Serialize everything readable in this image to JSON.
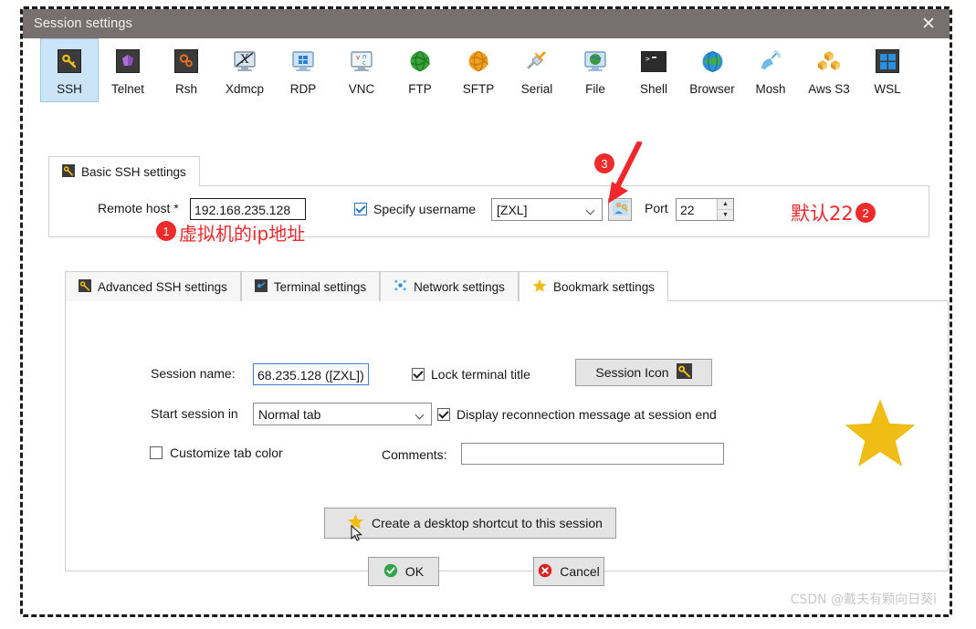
{
  "window": {
    "title": "Session settings",
    "close_icon": "close-icon"
  },
  "protocols": [
    {
      "label": "SSH",
      "icon": "key-icon",
      "selected": true
    },
    {
      "label": "Telnet",
      "icon": "purple-cube-icon",
      "selected": false
    },
    {
      "label": "Rsh",
      "icon": "orange-gears-icon",
      "selected": false
    },
    {
      "label": "Xdmcp",
      "icon": "monitor-x-icon",
      "selected": false
    },
    {
      "label": "RDP",
      "icon": "windows-monitor-icon",
      "selected": false
    },
    {
      "label": "VNC",
      "icon": "vnc-monitor-icon",
      "selected": false
    },
    {
      "label": "FTP",
      "icon": "green-globe-icon",
      "selected": false
    },
    {
      "label": "SFTP",
      "icon": "orange-globe-icon",
      "selected": false
    },
    {
      "label": "Serial",
      "icon": "serial-plug-icon",
      "selected": false
    },
    {
      "label": "File",
      "icon": "file-monitor-icon",
      "selected": false
    },
    {
      "label": "Shell",
      "icon": "terminal-icon",
      "selected": false
    },
    {
      "label": "Browser",
      "icon": "blue-globe-icon",
      "selected": false
    },
    {
      "label": "Mosh",
      "icon": "satellite-dish-icon",
      "selected": false
    },
    {
      "label": "Aws S3",
      "icon": "aws-cubes-icon",
      "selected": false
    },
    {
      "label": "WSL",
      "icon": "windows-logo-icon",
      "selected": false
    }
  ],
  "basic": {
    "tab_label": "Basic SSH settings",
    "tab_icon": "key-icon",
    "remote_host_label": "Remote host *",
    "remote_host_value": "192.168.235.128",
    "specify_username_label": "Specify username",
    "specify_username_checked": true,
    "username_value": "[ZXL]",
    "user_button_icon": "user-key-icon",
    "port_label": "Port",
    "port_value": "22"
  },
  "inner_tabs": [
    {
      "label": "Advanced SSH settings",
      "icon": "key-icon",
      "active": false
    },
    {
      "label": "Terminal settings",
      "icon": "terminal-blue-icon",
      "active": false
    },
    {
      "label": "Network settings",
      "icon": "network-dots-icon",
      "active": false
    },
    {
      "label": "Bookmark settings",
      "icon": "star-icon",
      "active": true
    }
  ],
  "bookmark": {
    "session_name_label": "Session name:",
    "session_name_value": "68.235.128 ([ZXL])",
    "lock_terminal_title_label": "Lock terminal title",
    "lock_terminal_title_checked": true,
    "session_icon_button_label": "Session Icon",
    "session_icon_button_icon": "key-icon",
    "start_session_in_label": "Start session in",
    "start_session_in_value": "Normal tab",
    "display_reconnection_label": "Display reconnection message at session end",
    "display_reconnection_checked": true,
    "customize_tab_color_label": "Customize tab color",
    "customize_tab_color_checked": false,
    "comments_label": "Comments:",
    "comments_value": "",
    "shortcut_button_label": "Create a desktop shortcut to this session",
    "shortcut_button_icon": "star-icon"
  },
  "footer": {
    "ok_label": "OK",
    "ok_icon": "green-check-icon",
    "cancel_label": "Cancel",
    "cancel_icon": "red-x-icon"
  },
  "annotations": {
    "badge1": "1",
    "badge2": "2",
    "badge3": "3",
    "note_host": "虚拟机的ip地址",
    "note_port": "默认22",
    "arrow_icon": "red-arrow-icon",
    "star_icon": "yellow-star-icon",
    "accent_red": "#f0282c",
    "accent_star": "#f0bc16"
  },
  "watermark": "CSDN @戴夫有颗向日葵i"
}
